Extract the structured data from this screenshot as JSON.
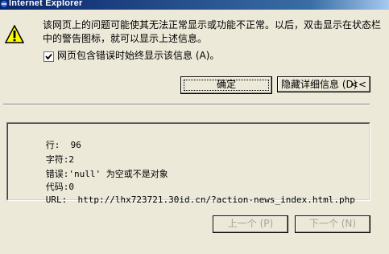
{
  "window": {
    "title": "Internet Explorer"
  },
  "message": {
    "text": "该网页上的问题可能使其无法正常显示或功能不正常。以后，双击显示在状态栏中的警告图标，就可以显示上述信息。"
  },
  "checkbox": {
    "label": "网页包含错误时始终显示该信息 (A)。",
    "checked": true
  },
  "buttons": {
    "ok": "确定",
    "details": "隐藏详细信息 (D)",
    "details_chev": "<<",
    "prev": "上一个 (P)",
    "next": "下一个 (N)"
  },
  "details": {
    "line_label": "行:",
    "line_value": "96",
    "char_label": "字符:",
    "char_value": "2",
    "error_label": "错误:",
    "error_value": "'null' 为空或不是对象",
    "code_label": "代码:",
    "code_value": "0",
    "url_label": "URL:",
    "url_value": "http://lhx723721.30id.cn/?action-news_index.html.php"
  },
  "icons": {
    "warning": "warning-icon",
    "ie": "ie-icon",
    "check": "check-icon"
  }
}
